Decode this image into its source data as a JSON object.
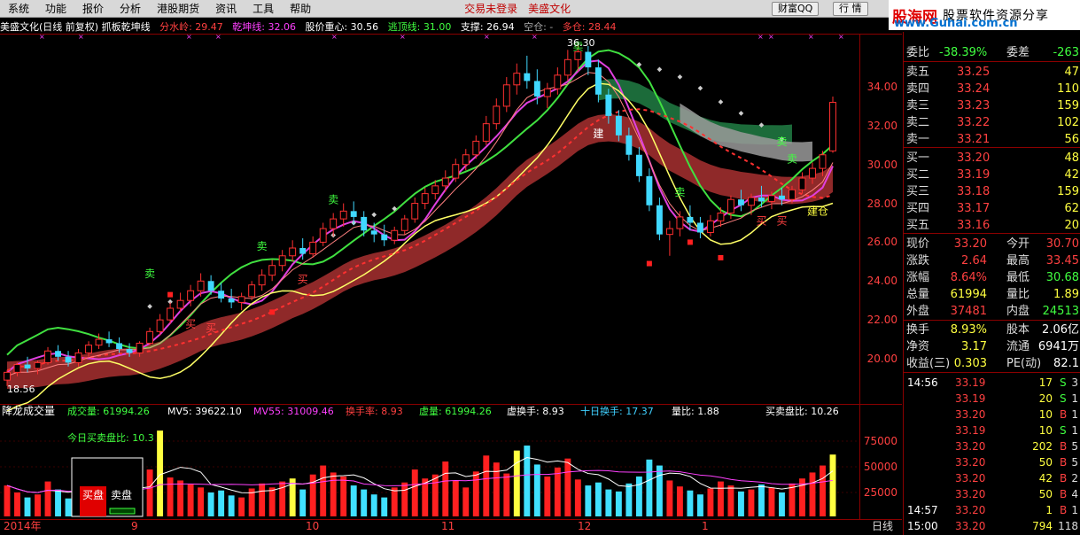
{
  "menu": {
    "items": [
      "系统",
      "功能",
      "报价",
      "分析",
      "港股期货",
      "资讯",
      "工具",
      "帮助"
    ],
    "center_text_1": "交易未登录",
    "center_text_2": "美盛文化",
    "btn_wealth": "财富QQ",
    "btn_quote": "行 情"
  },
  "brand": {
    "name": "股海网",
    "slogan": "股票软件资源分享",
    "url": "www.Guhai.com.cn"
  },
  "chart_header": {
    "title": "美盛文化(日线 前复权) 抓板乾坤线",
    "fenshuiling": "分水岭: 29.47",
    "qiankunxian": "乾坤线: 32.06",
    "zhongxin": "股价重心: 30.56",
    "taoding": "逃顶线: 31.00",
    "zhicheng": "支撑: 26.94",
    "kongcang": "空仓: -",
    "duocang": "多仓: 28.44"
  },
  "volume_header": {
    "title": "降龙成交量",
    "volume": "成交量: 61994.26",
    "mv5": "MV5: 39622.10",
    "mv55": "MV55: 31009.46",
    "turnover": "换手率: 8.93",
    "vvol": "虚量: 61994.26",
    "vturnover": "虚换手: 8.93",
    "ten_turnover": "十日换手: 17.37",
    "vol_ratio": "量比: 1.88",
    "buy_sell_ratio": "买卖盘比: 10.26",
    "today_ratio": "今日买卖盘比: 10.3",
    "buy_label": "买盘",
    "sell_label": "卖盘"
  },
  "price_axis": [
    "34.00",
    "32.00",
    "30.00",
    "28.00",
    "26.00",
    "24.00",
    "22.00",
    "20.00"
  ],
  "volume_axis": [
    "75000",
    "50000",
    "25000"
  ],
  "date_axis": [
    "2014年",
    "9",
    "10",
    "11",
    "12",
    "1"
  ],
  "bottom_right_label": "日线",
  "low_label": "18.56",
  "high_label": "36.30",
  "signals": {
    "sell": "卖",
    "buy": "买",
    "build": "建",
    "warehouse": "仓"
  },
  "quote": {
    "header": {
      "label": "委比",
      "value": "-38.39%",
      "label2": "委差",
      "value2": "-263"
    },
    "asks": [
      {
        "label": "卖五",
        "price": "33.25",
        "vol": "47"
      },
      {
        "label": "卖四",
        "price": "33.24",
        "vol": "110"
      },
      {
        "label": "卖三",
        "price": "33.23",
        "vol": "159"
      },
      {
        "label": "卖二",
        "price": "33.22",
        "vol": "102"
      },
      {
        "label": "卖一",
        "price": "33.21",
        "vol": "56"
      }
    ],
    "bids": [
      {
        "label": "买一",
        "price": "33.20",
        "vol": "48"
      },
      {
        "label": "买二",
        "price": "33.19",
        "vol": "42"
      },
      {
        "label": "买三",
        "price": "33.18",
        "vol": "159"
      },
      {
        "label": "买四",
        "price": "33.17",
        "vol": "62"
      },
      {
        "label": "买五",
        "price": "33.16",
        "vol": "20"
      }
    ],
    "stats": [
      {
        "l1": "现价",
        "v1": "33.20",
        "l2": "今开",
        "v2": "30.70"
      },
      {
        "l1": "涨跌",
        "v1": "2.64",
        "l2": "最高",
        "v2": "33.45"
      },
      {
        "l1": "涨幅",
        "v1": "8.64%",
        "l2": "最低",
        "v2": "30.68"
      },
      {
        "l1": "总量",
        "v1": "61994",
        "l2": "量比",
        "v2": "1.89"
      },
      {
        "l1": "外盘",
        "v1": "37481",
        "l2": "内盘",
        "v2": "24513"
      }
    ],
    "stats2": [
      {
        "l1": "换手",
        "v1": "8.93%",
        "l2": "股本",
        "v2": "2.06亿"
      },
      {
        "l1": "净资",
        "v1": "3.17",
        "l2": "流通",
        "v2": "6941万"
      },
      {
        "l1": "收益(三)",
        "v1": "0.303",
        "l2": "PE(动)",
        "v2": "82.1"
      }
    ],
    "ticks": [
      {
        "time": "14:56",
        "price": "33.19",
        "vol": "17",
        "bs": "S",
        "cnt": "3"
      },
      {
        "time": "",
        "price": "33.19",
        "vol": "20",
        "bs": "S",
        "cnt": "1"
      },
      {
        "time": "",
        "price": "33.20",
        "vol": "10",
        "bs": "B",
        "cnt": "1"
      },
      {
        "time": "",
        "price": "33.19",
        "vol": "10",
        "bs": "S",
        "cnt": "1"
      },
      {
        "time": "",
        "price": "33.20",
        "vol": "202",
        "bs": "B",
        "cnt": "5"
      },
      {
        "time": "",
        "price": "33.20",
        "vol": "50",
        "bs": "B",
        "cnt": "5"
      },
      {
        "time": "",
        "price": "33.20",
        "vol": "42",
        "bs": "B",
        "cnt": "2"
      },
      {
        "time": "",
        "price": "33.20",
        "vol": "50",
        "bs": "B",
        "cnt": "4"
      },
      {
        "time": "14:57",
        "price": "33.20",
        "vol": "1",
        "bs": "B",
        "cnt": "1"
      },
      {
        "time": "15:00",
        "price": "33.20",
        "vol": "794",
        "bs": "",
        "cnt": "118"
      }
    ]
  },
  "chart_data": {
    "type": "candlestick",
    "ylim": [
      18.5,
      36.3
    ],
    "candles": [
      [
        18.9,
        19.4,
        18.6,
        19.3
      ],
      [
        19.3,
        19.8,
        19.1,
        19.7
      ],
      [
        19.7,
        20.1,
        19.3,
        19.5
      ],
      [
        19.5,
        19.9,
        19.2,
        19.8
      ],
      [
        19.8,
        20.6,
        19.7,
        20.4
      ],
      [
        20.4,
        20.7,
        19.9,
        20.1
      ],
      [
        20.1,
        20.4,
        19.6,
        19.8
      ],
      [
        19.8,
        20.5,
        19.6,
        20.3
      ],
      [
        20.3,
        20.9,
        20.1,
        20.7
      ],
      [
        20.7,
        21.3,
        20.5,
        21.0
      ],
      [
        21.0,
        21.4,
        20.6,
        20.8
      ],
      [
        20.8,
        21.1,
        20.3,
        20.5
      ],
      [
        20.5,
        20.8,
        20.1,
        20.3
      ],
      [
        20.3,
        20.9,
        20.1,
        20.8
      ],
      [
        20.8,
        21.6,
        20.7,
        21.4
      ],
      [
        21.4,
        22.3,
        21.2,
        22.0
      ],
      [
        22.0,
        22.9,
        21.8,
        22.6
      ],
      [
        22.6,
        23.4,
        22.4,
        23.0
      ],
      [
        23.0,
        23.8,
        22.7,
        23.5
      ],
      [
        23.5,
        24.4,
        23.2,
        24.0
      ],
      [
        24.0,
        24.3,
        23.3,
        23.5
      ],
      [
        23.5,
        23.9,
        22.9,
        23.1
      ],
      [
        23.1,
        23.6,
        22.6,
        22.9
      ],
      [
        22.9,
        23.4,
        22.5,
        23.2
      ],
      [
        23.2,
        24.0,
        23.0,
        23.8
      ],
      [
        23.8,
        24.6,
        23.5,
        24.3
      ],
      [
        24.3,
        25.1,
        24.0,
        24.8
      ],
      [
        24.8,
        25.6,
        24.5,
        25.3
      ],
      [
        25.3,
        26.1,
        25.0,
        25.7
      ],
      [
        25.7,
        26.2,
        25.1,
        25.4
      ],
      [
        25.4,
        26.3,
        25.2,
        26.0
      ],
      [
        26.0,
        27.0,
        25.8,
        26.7
      ],
      [
        26.7,
        27.5,
        26.3,
        27.2
      ],
      [
        27.2,
        28.0,
        26.8,
        27.6
      ],
      [
        27.6,
        28.1,
        26.9,
        27.3
      ],
      [
        27.3,
        27.6,
        26.3,
        26.6
      ],
      [
        26.6,
        27.0,
        26.0,
        26.4
      ],
      [
        26.4,
        26.9,
        25.8,
        26.1
      ],
      [
        26.1,
        26.8,
        25.9,
        26.6
      ],
      [
        26.6,
        27.4,
        26.4,
        27.2
      ],
      [
        27.2,
        28.3,
        27.0,
        28.0
      ],
      [
        28.0,
        28.8,
        27.7,
        28.5
      ],
      [
        28.5,
        29.2,
        28.2,
        28.9
      ],
      [
        28.9,
        29.7,
        28.6,
        29.3
      ],
      [
        29.3,
        30.3,
        29.1,
        30.0
      ],
      [
        30.0,
        30.8,
        29.7,
        30.5
      ],
      [
        30.5,
        31.5,
        30.3,
        31.2
      ],
      [
        31.2,
        32.5,
        31.0,
        32.1
      ],
      [
        32.1,
        33.4,
        31.8,
        33.0
      ],
      [
        33.0,
        34.5,
        32.7,
        34.1
      ],
      [
        34.1,
        35.2,
        33.6,
        34.7
      ],
      [
        34.7,
        35.6,
        33.9,
        34.3
      ],
      [
        34.3,
        34.9,
        33.1,
        33.5
      ],
      [
        33.5,
        34.2,
        32.9,
        33.9
      ],
      [
        33.9,
        35.0,
        33.6,
        34.6
      ],
      [
        34.6,
        35.9,
        34.3,
        35.4
      ],
      [
        35.4,
        36.3,
        34.8,
        35.8
      ],
      [
        35.8,
        36.1,
        34.6,
        35.0
      ],
      [
        35.0,
        35.4,
        33.2,
        33.6
      ],
      [
        33.6,
        33.9,
        32.1,
        32.5
      ],
      [
        32.5,
        32.8,
        31.2,
        31.5
      ],
      [
        31.5,
        31.9,
        30.2,
        30.5
      ],
      [
        30.5,
        30.9,
        29.1,
        29.4
      ],
      [
        29.4,
        29.8,
        27.6,
        27.9
      ],
      [
        27.9,
        28.3,
        26.1,
        26.4
      ],
      [
        26.4,
        27.1,
        25.3,
        26.7
      ],
      [
        26.7,
        27.6,
        26.3,
        27.3
      ],
      [
        27.3,
        27.9,
        26.6,
        27.0
      ],
      [
        27.0,
        27.3,
        26.2,
        26.5
      ],
      [
        26.5,
        27.4,
        26.3,
        27.1
      ],
      [
        27.1,
        27.8,
        26.8,
        27.5
      ],
      [
        27.5,
        28.4,
        27.2,
        28.2
      ],
      [
        28.2,
        28.7,
        27.6,
        27.9
      ],
      [
        27.9,
        28.5,
        27.4,
        28.3
      ],
      [
        28.3,
        28.9,
        27.8,
        28.1
      ],
      [
        28.1,
        28.6,
        27.7,
        28.4
      ],
      [
        28.4,
        28.8,
        27.9,
        28.2
      ],
      [
        28.2,
        28.9,
        28.0,
        28.7
      ],
      [
        28.7,
        29.6,
        28.5,
        29.3
      ],
      [
        29.3,
        30.1,
        29.0,
        29.8
      ],
      [
        29.8,
        30.7,
        29.4,
        30.5
      ],
      [
        30.7,
        33.5,
        30.6,
        33.2
      ]
    ],
    "volumes": [
      31000,
      24000,
      19000,
      22000,
      35000,
      27000,
      18000,
      26000,
      33000,
      41000,
      25000,
      21000,
      17000,
      38000,
      47000,
      86000,
      39000,
      36000,
      32000,
      29000,
      24000,
      26000,
      21000,
      19000,
      28000,
      33000,
      29000,
      35000,
      38000,
      27000,
      42000,
      51000,
      44000,
      40000,
      31000,
      27000,
      22000,
      19000,
      29000,
      34000,
      47000,
      38000,
      42000,
      55000,
      36000,
      29000,
      45000,
      61000,
      54000,
      43000,
      66000,
      71000,
      52000,
      40000,
      49000,
      58000,
      37000,
      31000,
      34000,
      27000,
      25000,
      33000,
      40000,
      57000,
      51000,
      36000,
      30000,
      26000,
      22000,
      28000,
      35000,
      31000,
      25000,
      27000,
      32000,
      29000,
      24000,
      33000,
      38000,
      44000,
      51000,
      61994
    ]
  }
}
